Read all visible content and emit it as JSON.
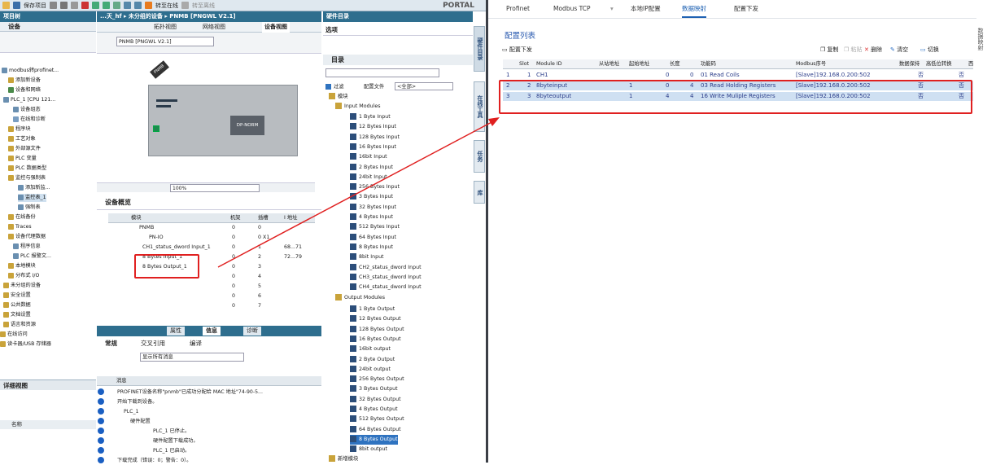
{
  "toolbar": {
    "project_label": "保存项目",
    "go_online": "转至在线",
    "go_offline": "转至离线",
    "portal": "PORTAL"
  },
  "left": {
    "title": "项目树",
    "devices_tab": "设备",
    "detail_view": "详细视图",
    "name_col": "名称",
    "tree": [
      "modbus转profinet...",
      "添加新设备",
      "设备和网络",
      "PLC_1 [CPU 121...",
      "设备组态",
      "在线和诊断",
      "程序块",
      "工艺对象",
      "外部源文件",
      "PLC 变量",
      "PLC 数据类型",
      "监控与强制表",
      "添加新监...",
      "监控表_1",
      "强制表",
      "在线备份",
      "Traces",
      "设备代理数据",
      "程序信息",
      "PLC 报警文...",
      "本地模块",
      "分布式 I/O",
      "未分组的设备",
      "安全设置",
      "公共数据",
      "文档设置",
      "语言和资源",
      "在线访问",
      "读卡器/USB 存储器"
    ]
  },
  "center": {
    "breadcrumb": "...天_hf  ▸  未分组的设备  ▸  PNMB [PNGWL V2.1]",
    "tabs": [
      "拓扑视图",
      "网络视图",
      "设备视图"
    ],
    "device_select": "PNMB [PNGWL V2.1]",
    "device_label": "PNMB",
    "module_label": "DP-NORM",
    "zoom": "100%",
    "overview_title": "设备概览",
    "overview_headers": [
      "模块",
      "机架",
      "插槽",
      "I 地址"
    ],
    "overview_rows": [
      {
        "name": "PNMB",
        "rack": "0",
        "slot": "0",
        "addr": ""
      },
      {
        "name": "PN-IO",
        "rack": "0",
        "slot": "0 X1",
        "addr": ""
      },
      {
        "name": "CH1_status_dword Input_1",
        "rack": "0",
        "slot": "1",
        "addr": "68...71"
      },
      {
        "name": "8 Bytes Input_1",
        "rack": "0",
        "slot": "2",
        "addr": "72...79"
      },
      {
        "name": "8 Bytes Output_1",
        "rack": "0",
        "slot": "3",
        "addr": ""
      },
      {
        "name": "",
        "rack": "0",
        "slot": "4",
        "addr": ""
      },
      {
        "name": "",
        "rack": "0",
        "slot": "5",
        "addr": ""
      },
      {
        "name": "",
        "rack": "0",
        "slot": "6",
        "addr": ""
      },
      {
        "name": "",
        "rack": "0",
        "slot": "7",
        "addr": ""
      }
    ],
    "inspector_tabs": [
      "属性",
      "信息",
      "诊断"
    ],
    "msg_tabs": [
      "常规",
      "交叉引用",
      "编译"
    ],
    "msg_filter": "显示所有消息",
    "msg_header": "消息",
    "messages": [
      "PROFINET设备名称\"pnmb\"已成功分配给 MAC 地址\"74-90-5...",
      "开始下载到设备。",
      "PLC_1",
      "硬件配置",
      "PLC_1 已停止。",
      "硬件配置下载成功。",
      "PLC_1 已启动。",
      "下载完成（错误：0；警告：0）。"
    ]
  },
  "catalog": {
    "title": "硬件目录",
    "options": "选项",
    "section": "目录",
    "filter": "过滤",
    "profile_label": "配置文件",
    "profile_value": "<全部>",
    "module_root": "模块",
    "input_group": "Input Modules",
    "inputs": [
      "1 Byte Input",
      "12 Bytes Input",
      "128 Bytes Input",
      "16 Bytes Input",
      "16bit Input",
      "2 Bytes Input",
      "24bit Input",
      "256 Bytes Input",
      "3 Bytes Input",
      "32 Bytes Input",
      "4 Bytes Input",
      "512 Bytes Input",
      "64 Bytes Input",
      "8 Bytes Input",
      "8bit Input",
      "CH2_status_dword Input",
      "CH3_status_dword Input",
      "CH4_status_dword Input"
    ],
    "output_group": "Output Modules",
    "outputs": [
      "1 Byte Output",
      "12 Bytes Output",
      "128 Bytes Output",
      "16 Bytes Output",
      "16bit output",
      "2 Byte Output",
      "24bit output",
      "256 Bytes Output",
      "3 Bytes Output",
      "32 Bytes Output",
      "4 Bytes Output",
      "512 Bytes Output",
      "64 Bytes Output",
      "8 Bytes Output",
      "8bit output"
    ],
    "bottom": "新增模块",
    "side_tabs": [
      "硬件目录",
      "在线工具",
      "任务",
      "库"
    ]
  },
  "right": {
    "tabs": [
      "Profinet",
      "Modbus TCP",
      "本地IP配置",
      "数据映射",
      "配置下发"
    ],
    "section": "配置列表",
    "sub": "配置下发",
    "actions": [
      "复制",
      "粘贴",
      "删除",
      "清空",
      "切换"
    ],
    "side": "数据映射",
    "headers": [
      "Slot",
      "Module ID",
      "从站地址",
      "起始地址",
      "长度",
      "功能码",
      "Modbus序号",
      "数据保持",
      "高低位转换",
      "西"
    ],
    "rows": [
      {
        "n": "1",
        "slot": "1",
        "module": "CH1",
        "slave": "",
        "start": "0",
        "len": "0",
        "fc": "01 Read Coils",
        "seq": "[Slave]192.168.0.200:502",
        "keep": "否",
        "swap": "否"
      },
      {
        "n": "2",
        "slot": "2",
        "module": "8byteinput",
        "slave": "1",
        "start": "0",
        "len": "4",
        "fc": "03 Read Holding Registers",
        "seq": "[Slave]192.168.0.200:502",
        "keep": "否",
        "swap": "否"
      },
      {
        "n": "3",
        "slot": "3",
        "module": "8byteoutput",
        "slave": "1",
        "start": "4",
        "len": "4",
        "fc": "16 Write Muliple Registers",
        "seq": "[Slave]192.168.0.200:502",
        "keep": "否",
        "swap": "否"
      }
    ]
  },
  "colors": {
    "accent": "#2e6e8e",
    "highlight": "#e02020",
    "selection": "#2f73c0"
  }
}
